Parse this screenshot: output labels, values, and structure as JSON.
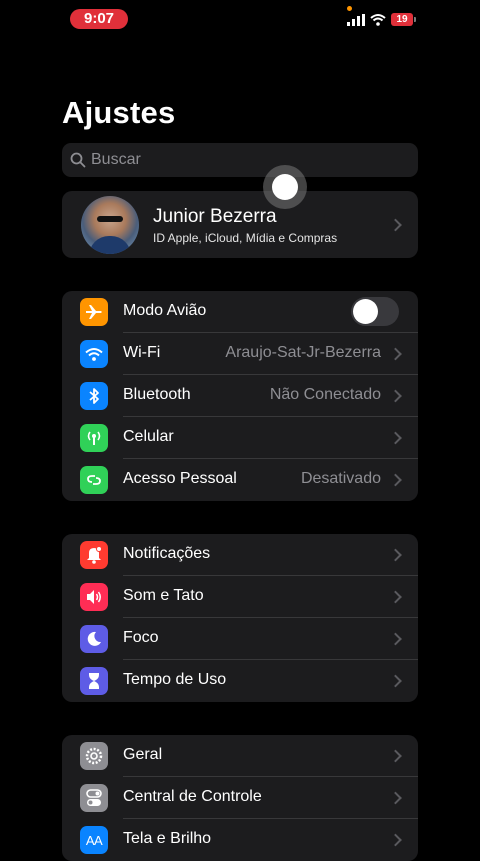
{
  "status_bar": {
    "time": "9:07",
    "battery": "19"
  },
  "title": "Ajustes",
  "search": {
    "placeholder": "Buscar"
  },
  "profile": {
    "name": "Junior Bezerra",
    "subtitle": "ID Apple, iCloud, Mídia e Compras"
  },
  "groups": [
    {
      "rows": [
        {
          "label": "Modo Avião",
          "value": "",
          "icon": "airplane-icon",
          "color": "#ff9500",
          "toggle_on": false
        },
        {
          "label": "Wi-Fi",
          "value": "Araujo-Sat-Jr-Bezerra",
          "icon": "wifi-icon",
          "color": "#0a84ff"
        },
        {
          "label": "Bluetooth",
          "value": "Não Conectado",
          "icon": "bluetooth-icon",
          "color": "#0a84ff"
        },
        {
          "label": "Celular",
          "value": "",
          "icon": "antenna-icon",
          "color": "#30d158"
        },
        {
          "label": "Acesso Pessoal",
          "value": "Desativado",
          "icon": "hotspot-icon",
          "color": "#30d158"
        }
      ]
    },
    {
      "rows": [
        {
          "label": "Notificações",
          "value": "",
          "icon": "bell-icon",
          "color": "#ff3b30"
        },
        {
          "label": "Som e Tato",
          "value": "",
          "icon": "speaker-icon",
          "color": "#ff2d55"
        },
        {
          "label": "Foco",
          "value": "",
          "icon": "moon-icon",
          "color": "#5e5ce6"
        },
        {
          "label": "Tempo de Uso",
          "value": "",
          "icon": "hourglass-icon",
          "color": "#5e5ce6"
        }
      ]
    },
    {
      "rows": [
        {
          "label": "Geral",
          "value": "",
          "icon": "gear-icon",
          "color": "#8e8e93"
        },
        {
          "label": "Central de Controle",
          "value": "",
          "icon": "switches-icon",
          "color": "#8e8e93"
        },
        {
          "label": "Tela e Brilho",
          "value": "",
          "icon": "text-size-icon",
          "color": "#0a84ff",
          "icon_text": "AA"
        }
      ]
    }
  ]
}
